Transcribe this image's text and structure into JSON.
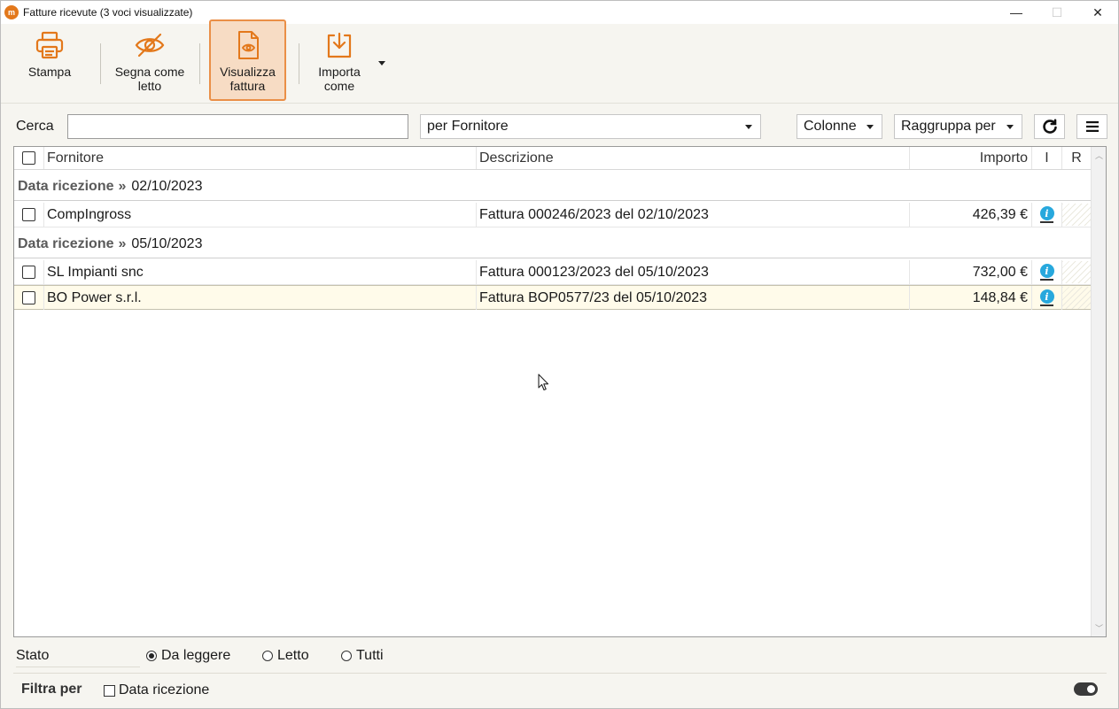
{
  "window": {
    "title": "Fatture ricevute (3 voci visualizzate)",
    "app_icon_glyph": "m",
    "controls": {
      "minimize": "—",
      "maximize": "☐",
      "close": "✕"
    }
  },
  "toolbar": {
    "stampa": "Stampa",
    "segna_line1": "Segna come",
    "segna_line2": "letto",
    "visualizza_line1": "Visualizza",
    "visualizza_line2": "fattura",
    "importa_line1": "Importa",
    "importa_line2": "come"
  },
  "search": {
    "label": "Cerca",
    "value": "",
    "scope": "per Fornitore",
    "columns_button": "Colonne",
    "group_button": "Raggruppa per"
  },
  "grid": {
    "headers": {
      "fornitore": "Fornitore",
      "descrizione": "Descrizione",
      "importo": "Importo",
      "i": "I",
      "r": "R"
    },
    "groups": [
      {
        "key": "Data ricezione",
        "sep": "»",
        "value": "02/10/2023",
        "rows": [
          {
            "fornitore": "CompIngross",
            "descrizione": "Fattura 000246/2023 del 02/10/2023",
            "importo": "426,39 €",
            "info": "i"
          }
        ]
      },
      {
        "key": "Data ricezione",
        "sep": "»",
        "value": "05/10/2023",
        "rows": [
          {
            "fornitore": "SL Impianti snc",
            "descrizione": "Fattura 000123/2023 del 05/10/2023",
            "importo": "732,00 €",
            "info": "i"
          },
          {
            "fornitore": "BO Power s.r.l.",
            "descrizione": "Fattura BOP0577/23 del 05/10/2023",
            "importo": "148,84 €",
            "info": "i"
          }
        ]
      }
    ]
  },
  "footer": {
    "stato_label": "Stato",
    "stato_options": [
      "Da leggere",
      "Letto",
      "Tutti"
    ],
    "stato_selected": "Da leggere",
    "filtra_label": "Filtra per",
    "filter_checkbox": "Data ricezione"
  },
  "colors": {
    "accent": "#e3781b",
    "active_button_bg": "#f7dcc4",
    "info_icon": "#27a8dd",
    "highlight_row": "#fffbea"
  }
}
